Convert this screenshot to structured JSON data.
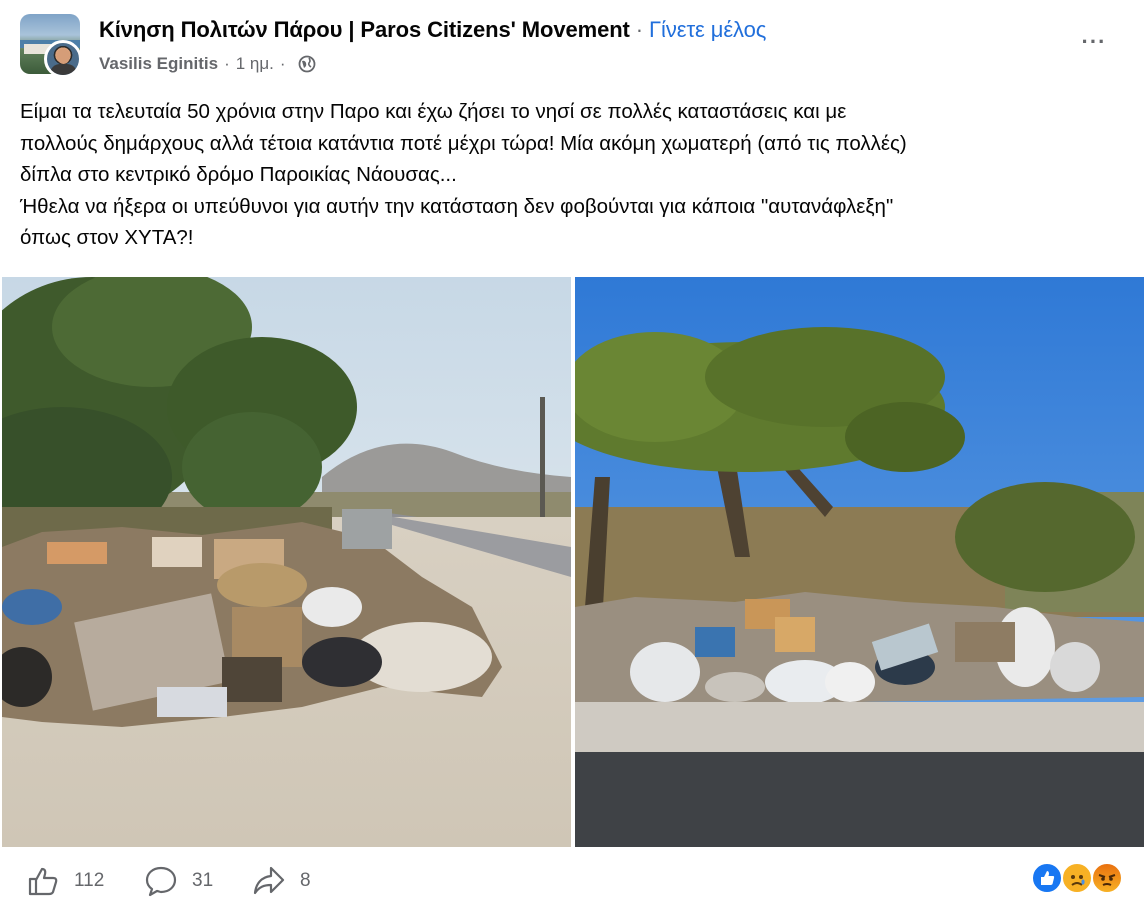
{
  "header": {
    "group_name": "Κίνηση Πολιτών Πάρου | Paros Citizens' Movement",
    "separator": "·",
    "join_label": "Γίνετε μέλος",
    "author": "Vasilis Eginitis",
    "meta_separator": "·",
    "time_ago": "1 ημ.",
    "meta_separator_2": "·",
    "privacy_icon": "globe-icon",
    "more_icon": "more-horizontal-icon",
    "more_label": "···"
  },
  "post": {
    "lines": [
      "Είμαι τα τελευταία 50 χρόνια στην Παρο και έχω ζήσει το νησί σε πολλές καταστάσεις και με",
      "πολλούς δημάρχους αλλά τέτοια κατάντια ποτέ μέχρι τώρα! Μία ακόμη χωματερή (από τις πολλές)",
      "δίπλα στο κεντρικό δρόμο Παροικίας Νάουσας...",
      "Ήθελα να ήξερα οι υπεύθυνοι για αυτήν την κατάσταση δεν φοβούνται για κάποια \"αυτανάφλεξη\"",
      "όπως στον ΧΥΤΑ?!"
    ]
  },
  "footer": {
    "like_count": "112",
    "comment_count": "31",
    "share_count": "8",
    "like_icon": "thumbs-up-icon",
    "comment_icon": "comment-bubble-icon",
    "share_icon": "share-arrow-icon",
    "reactions": [
      "like-reaction-icon",
      "sad-reaction-icon",
      "angry-reaction-icon"
    ]
  },
  "colors": {
    "link_blue": "#216fdb",
    "secondary_text": "#65676b",
    "primary_text": "#050505",
    "like_blue": "#1877f2"
  }
}
